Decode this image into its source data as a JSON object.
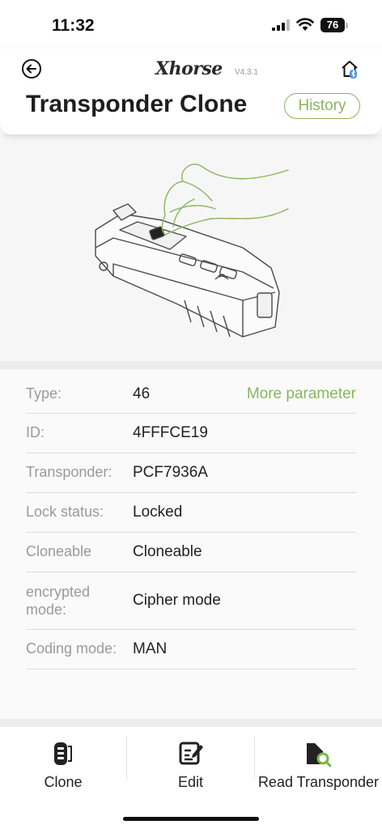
{
  "status": {
    "time": "11:32",
    "battery": "76"
  },
  "header": {
    "logo": "Xhorse",
    "version": "V4.3.1",
    "title": "Transponder Clone",
    "history_label": "History"
  },
  "info": {
    "more_label": "More parameter",
    "rows": [
      {
        "label": "Type:",
        "value": "46"
      },
      {
        "label": "ID:",
        "value": "4FFFCE19"
      },
      {
        "label": "Transponder:",
        "value": "PCF7936A"
      },
      {
        "label": "Lock status:",
        "value": "Locked"
      },
      {
        "label": "Cloneable",
        "value": "Cloneable"
      },
      {
        "label": "encrypted mode:",
        "value": "Cipher mode"
      },
      {
        "label": "Coding mode:",
        "value": "MAN"
      }
    ]
  },
  "tabs": [
    {
      "label": "Clone",
      "icon": "car-key-icon"
    },
    {
      "label": "Edit",
      "icon": "edit-icon"
    },
    {
      "label": "Read Transponder",
      "icon": "read-transponder-icon"
    }
  ],
  "colors": {
    "accent": "#8ab55e",
    "label": "#9a9a9a"
  }
}
